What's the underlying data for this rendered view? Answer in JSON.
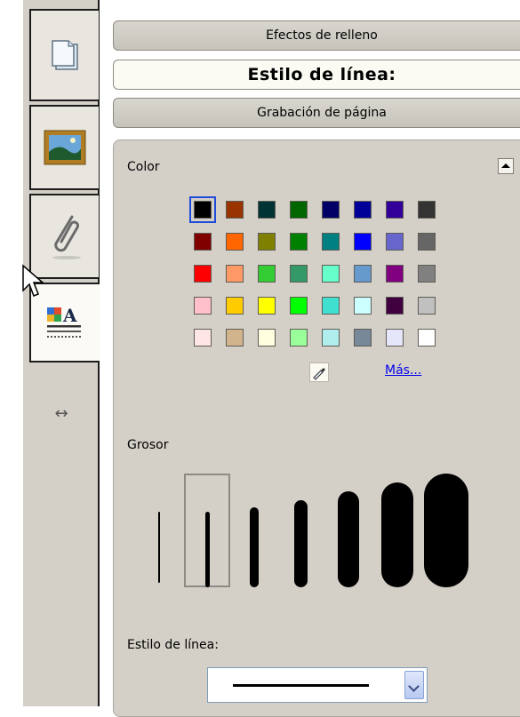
{
  "accordion": {
    "fill_effects": "Efectos de relleno",
    "line_style": "Estilo de línea:",
    "page_recording": "Grabación de página"
  },
  "sidebar": {
    "tabs": [
      {
        "name": "page-sorter-icon"
      },
      {
        "name": "gallery-icon"
      },
      {
        "name": "attachments-icon"
      },
      {
        "name": "properties-icon"
      }
    ],
    "expand_icon": "horizontal-arrows-icon"
  },
  "panel": {
    "color_label": "Color",
    "more_link": "Más...",
    "thickness_label": "Grosor",
    "line_style_label": "Estilo de línea:"
  },
  "swatch_colors": [
    [
      "#000000",
      "#993300",
      "#003333",
      "#006600",
      "#000066",
      "#000099",
      "#330099",
      "#333333"
    ],
    [
      "#800000",
      "#ff6600",
      "#808000",
      "#008000",
      "#008080",
      "#0000ff",
      "#6666cc",
      "#666666"
    ],
    [
      "#ff0000",
      "#ff9966",
      "#33cc33",
      "#339966",
      "#66ffcc",
      "#6699cc",
      "#800080",
      "#808080"
    ],
    [
      "#ffc0cb",
      "#ffcc00",
      "#ffff00",
      "#00ff00",
      "#40e0d0",
      "#ccffff",
      "#400040",
      "#c0c0c0"
    ],
    [
      "#ffe6e6",
      "#d2b48c",
      "#ffffe0",
      "#99ff99",
      "#b0eeee",
      "#778899",
      "#e6e6fa",
      "#ffffff"
    ]
  ],
  "selected_swatch": {
    "row": 0,
    "col": 0
  },
  "thickness_options": {
    "count": 7,
    "selected_index": 1
  }
}
